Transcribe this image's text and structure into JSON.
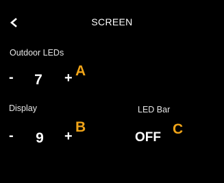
{
  "header": {
    "back_icon": "chevron-left-icon",
    "title": "SCREEN"
  },
  "outdoor_leds": {
    "label": "Outdoor LEDs",
    "decrement_label": "-",
    "value": "7",
    "increment_label": "+",
    "marker": "A"
  },
  "display": {
    "label": "Display",
    "decrement_label": "-",
    "value": "9",
    "increment_label": "+",
    "marker": "B"
  },
  "led_bar": {
    "label": "LED Bar",
    "value": "OFF",
    "marker": "C"
  },
  "colors": {
    "background": "#000000",
    "text": "#ffffff",
    "marker": "#f0a418"
  }
}
